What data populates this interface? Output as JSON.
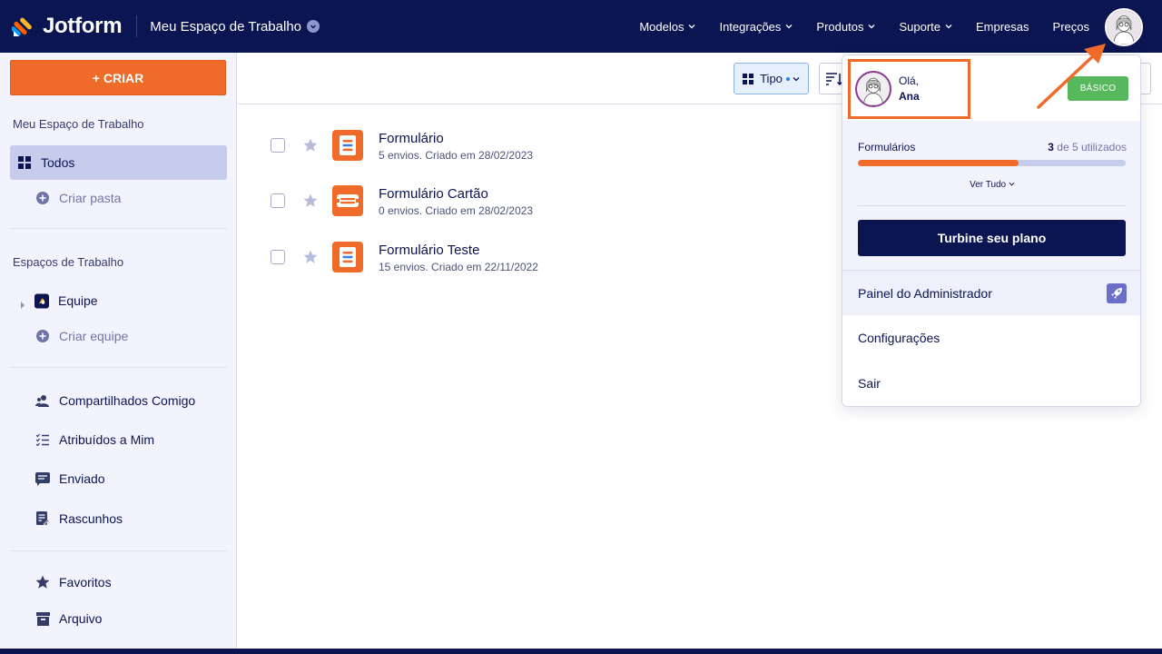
{
  "header": {
    "brand": "Jotform",
    "workspace": "Meu Espaço de Trabalho",
    "nav": [
      {
        "label": "Modelos",
        "dropdown": true
      },
      {
        "label": "Integrações",
        "dropdown": true
      },
      {
        "label": "Produtos",
        "dropdown": true
      },
      {
        "label": "Suporte",
        "dropdown": true
      },
      {
        "label": "Empresas",
        "dropdown": false
      },
      {
        "label": "Preços",
        "dropdown": false
      }
    ]
  },
  "sidebar": {
    "create_label": "+ CRIAR",
    "my_workspace_title": "Meu Espaço de Trabalho",
    "all_label": "Todos",
    "create_folder": "Criar pasta",
    "workspaces_title": "Espaços de Trabalho",
    "team_label": "Equipe",
    "create_team": "Criar equipe",
    "shared": "Compartilhados Comigo",
    "assigned": "Atribuídos a Mim",
    "sent": "Enviado",
    "drafts": "Rascunhos",
    "favorites": "Favoritos",
    "archive": "Arquivo"
  },
  "toolbar": {
    "type_label": "Tipo"
  },
  "forms": [
    {
      "title": "Formulário",
      "meta": "5 envios. Criado em 28/02/2023",
      "icon": "form-icon"
    },
    {
      "title": "Formulário Cartão",
      "meta": "0 envios. Criado em 28/02/2023",
      "icon": "card-form-icon"
    },
    {
      "title": "Formulário Teste",
      "meta": "15 envios. Criado em 22/11/2022",
      "icon": "form-icon"
    }
  ],
  "account_menu": {
    "greeting": "Olá,",
    "user_name": "Ana",
    "plan_badge": "BÁSICO",
    "usage_label": "Formulários",
    "usage_used": "3",
    "usage_rest": " de 5 utilizados",
    "usage_fraction": 0.6,
    "view_all": "Ver Tudo",
    "upgrade": "Turbine seu plano",
    "admin_panel": "Painel do Administrador",
    "settings": "Configurações",
    "logout": "Sair"
  },
  "colors": {
    "navy": "#0a1551",
    "orange": "#f06b29",
    "green": "#58b85e",
    "sidebar_bg": "#f3f3fe"
  }
}
